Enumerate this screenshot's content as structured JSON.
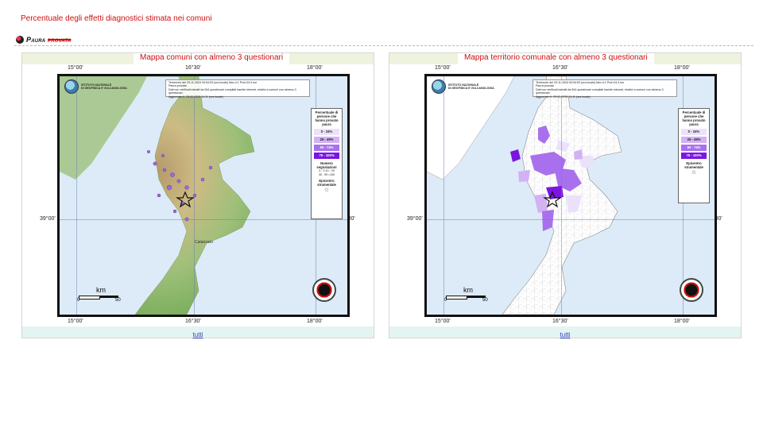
{
  "page": {
    "heading": "Percentuale degli effetti diagnostici stimata nei comuni",
    "section_title_main": "Paura",
    "section_title_flag": "provata"
  },
  "colors": {
    "accent_red": "#cc1111",
    "sea": "#dcebf7",
    "link": "#2a3fb0",
    "class_0_24": "#ece1fb",
    "class_25_49": "#d3b1f5",
    "class_50_74": "#a970ee",
    "class_75_100": "#7a16e0"
  },
  "panels": [
    {
      "id": "left",
      "caption": "Mappa comuni con almeno 3 questionari",
      "link": "tutti",
      "top_ticks": [
        "15°00'",
        "16°30'",
        "18°00'"
      ],
      "bottom_ticks": [
        "15°00'",
        "16°30'",
        "18°00'"
      ],
      "lat_tick": "39°00'",
      "info_lines": [
        "Terremoto del 29-11-2024 00:54:53 (ora locale) Mw=4.1 Prof=24.4 km",
        "Paura provata",
        "Dati non verificati estratti da 544 questionari compilati tramite internet, relativi a comuni con almeno 3 questionari",
        "Aggiornato il: 25-02-2025 11:11 (ora locale)"
      ],
      "logo_text": [
        "ISTITUTO NAZIONALE",
        "DI GEOFISICA E VULCANOLOGIA"
      ],
      "place_label": "Catanzaro",
      "legend": {
        "title": "Percentuale di persone che hanno provato paura",
        "classes": [
          "0 - 24%",
          "25 - 49%",
          "50 - 74%",
          "75 - 100%"
        ],
        "count_title": "Numero segnalazioni",
        "count_sizes": [
          "3 - 9",
          "10 - 29",
          "30 - 99",
          ">100"
        ],
        "epicenter_title": "Epicentro strumentale"
      },
      "scale": {
        "unit": "km",
        "min": "0",
        "max": "50"
      }
    },
    {
      "id": "right",
      "caption": "Mappa territorio comunale con almeno 3 questionari",
      "link": "tutti",
      "top_ticks": [
        "15°00'",
        "16°30'",
        "18°00'"
      ],
      "bottom_ticks": [
        "15°00'",
        "16°30'",
        "18°00'"
      ],
      "lat_tick": "39°00'",
      "info_lines": [
        "Terremoto del 29-11-2024 00:54:53 (ora locale) Mw=4.1 Prof=24.4 km",
        "Paura provata",
        "Dati non verificati estratti da 544 questionari compilati tramite internet, relativi a comuni con almeno 3 questionari",
        "Aggiornato il: 25-02-2025 11:11 (ora locale)"
      ],
      "logo_text": [
        "ISTITUTO NAZIONALE",
        "DI GEOFISICA E VULCANOLOGIA"
      ],
      "legend": {
        "title": "Percentuale di persone che hanno provato paura",
        "classes": [
          "0 - 24%",
          "25 - 49%",
          "50 - 74%",
          "75 - 100%"
        ],
        "epicenter_title": "Epicentro strumentale"
      },
      "scale": {
        "unit": "km",
        "min": "0",
        "max": "50"
      }
    }
  ]
}
